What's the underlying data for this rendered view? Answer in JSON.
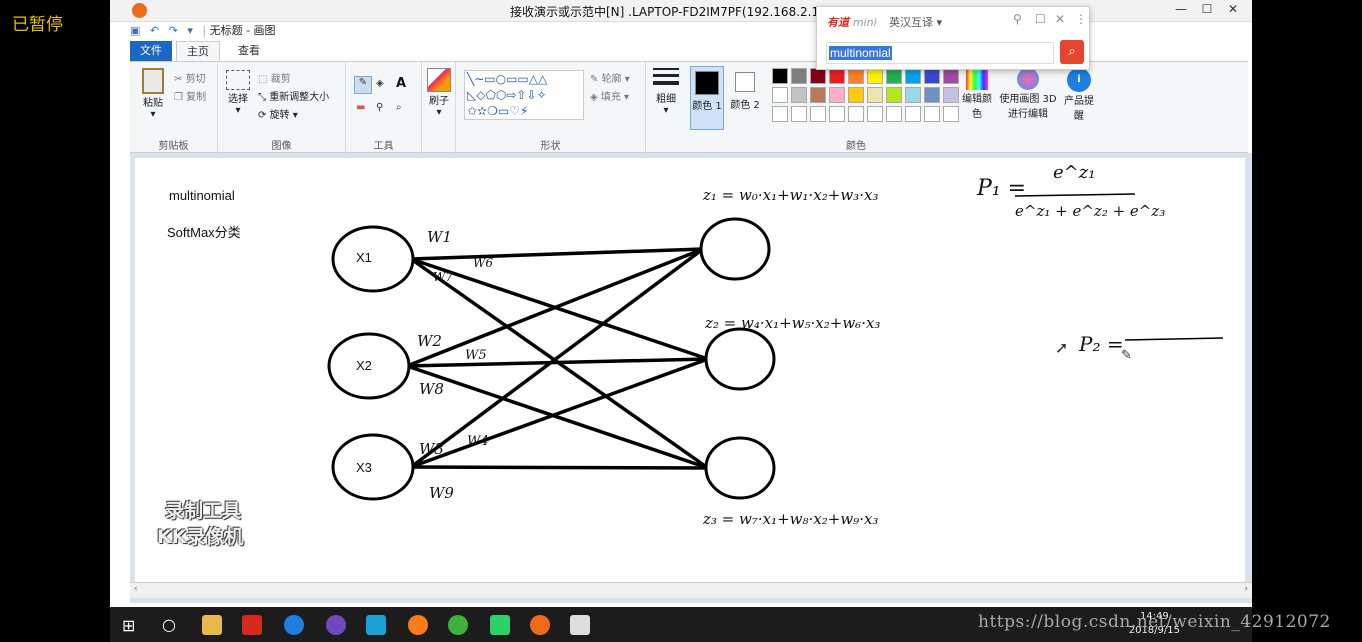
{
  "overlay": {
    "paused_label": "已暂停"
  },
  "remote": {
    "title": "接收演示或示范中[N] .LAPTOP-FD2IM7PF(192.168.2.122)",
    "min": "—",
    "max": "☐",
    "close": "✕"
  },
  "paint": {
    "title": "无标题 - 画图",
    "tabs": [
      "文件",
      "主页",
      "查看"
    ],
    "groups": {
      "clipboard": "剪贴板",
      "image": "图像",
      "tools": "工具",
      "shapes": "形状",
      "colors": "颜色"
    },
    "clipboard": {
      "paste": "粘贴",
      "cut": "剪切",
      "copy": "复制"
    },
    "image": {
      "select": "选择",
      "crop": "裁剪",
      "resize": "重新调整大小",
      "rotate": "旋转"
    },
    "brushes": "刷子",
    "shapes_opts": {
      "outline": "轮廓",
      "fill": "填充"
    },
    "size": "粗细",
    "color1": "颜色 1",
    "color2": "颜色 2",
    "edit_colors": "编辑颜色",
    "paint3d": "使用画图 3D 进行编辑",
    "product_tip": "产品提醒",
    "palette": [
      "#000000",
      "#7f7f7f",
      "#880015",
      "#ed1c24",
      "#ff7f27",
      "#fff200",
      "#22b14c",
      "#00a2e8",
      "#3f48cc",
      "#a349a4",
      "#ffffff",
      "#c3c3c3",
      "#b97a57",
      "#ffaec9",
      "#ffc90e",
      "#efe4b0",
      "#b5e61d",
      "#99d9ea",
      "#7092be",
      "#c8bfe7"
    ]
  },
  "canvas": {
    "text1": "multinomial",
    "text2": "SoftMax分类",
    "inputs": [
      "X1",
      "X2",
      "X3"
    ],
    "weights": [
      "W1",
      "W6",
      "W7",
      "W2",
      "W5",
      "W8",
      "W3",
      "W4",
      "W9"
    ],
    "eq_z1": "z₁ = w₀·x₁+w₁·x₂+w₃·x₃",
    "eq_z2": "z₂ = w₄·x₁+w₅·x₂+w₆·x₃",
    "eq_z3": "z₃ = w₇·x₁+w₈·x₂+w₉·x₃",
    "p1": "P₁ =",
    "p1_num": "e^z₁",
    "p1_den": "e^z₁ + e^z₂ + e^z₃",
    "p2": "P₂ ="
  },
  "watermark": {
    "line1": "录制工具",
    "line2": "KK录像机"
  },
  "dict": {
    "brand": "有道",
    "mini": "mini",
    "mode": "英汉互译 ▾",
    "query": "multinomial"
  },
  "taskbar": {
    "time": "14:49",
    "date": "2018/9/15"
  },
  "blog_watermark": "https://blog.csdn.net/weixin_42912072"
}
